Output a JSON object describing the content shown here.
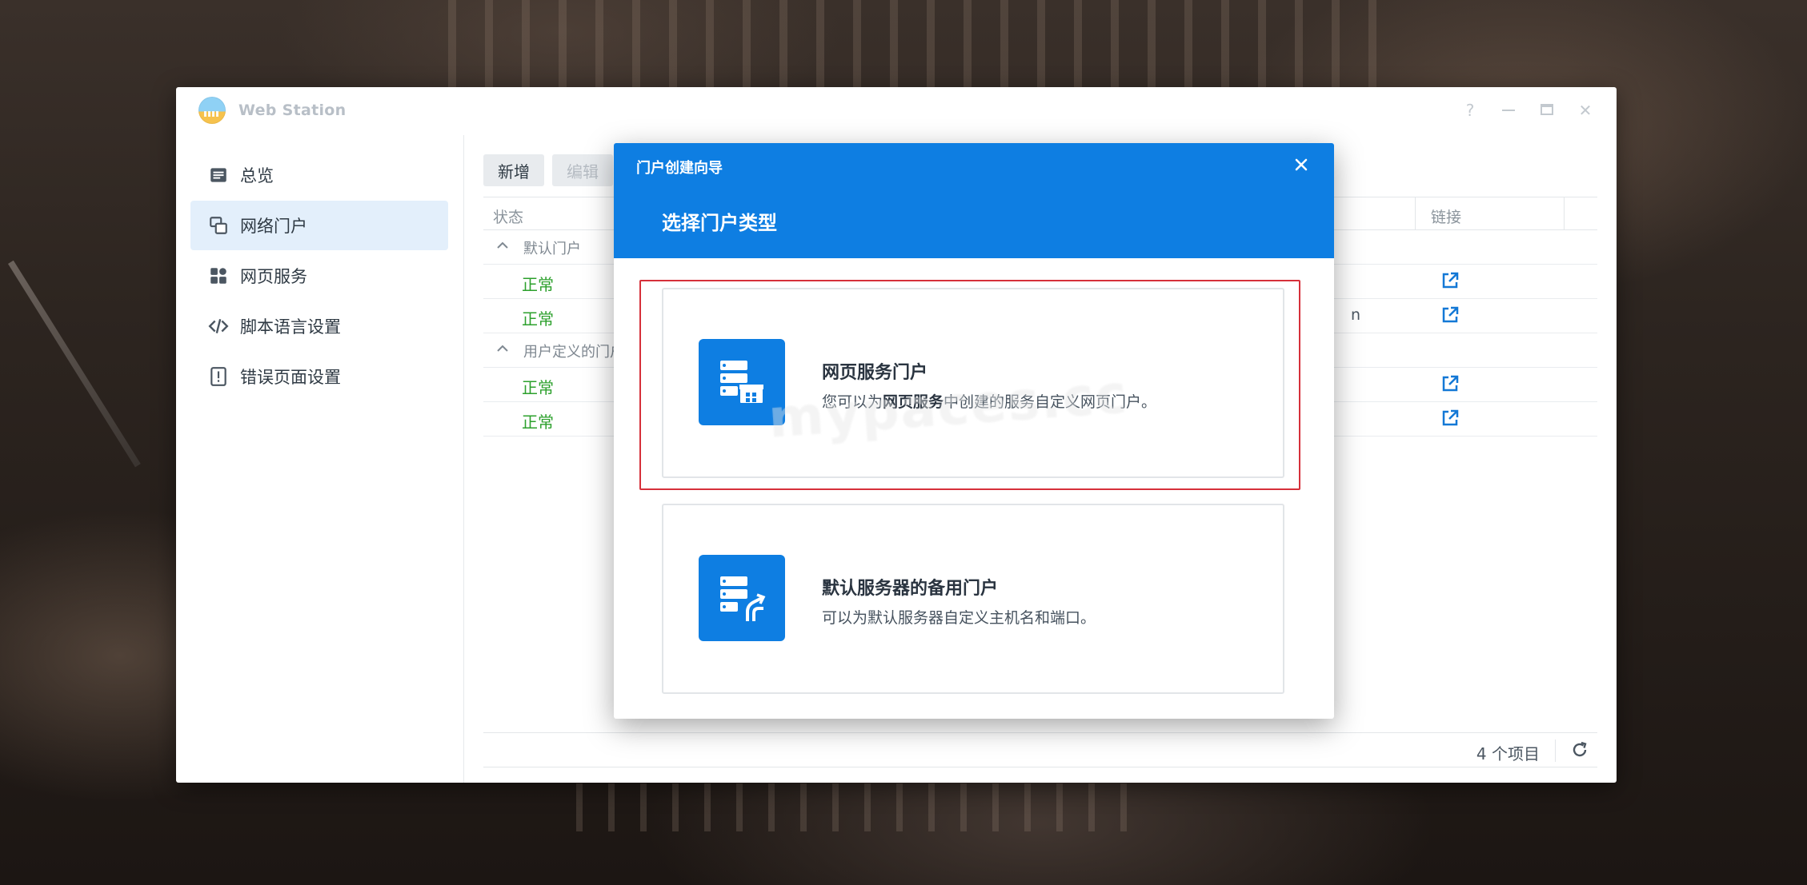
{
  "window": {
    "title": "Web Station",
    "controls": [
      "?",
      "minimize",
      "maximize",
      "close"
    ]
  },
  "sidebar": {
    "items": [
      {
        "label": "总览",
        "icon": "overview-icon",
        "active": false
      },
      {
        "label": "网络门户",
        "icon": "web-portal-icon",
        "active": true
      },
      {
        "label": "网页服务",
        "icon": "web-service-icon",
        "active": false
      },
      {
        "label": "脚本语言设置",
        "icon": "code-icon",
        "active": false
      },
      {
        "label": "错误页面设置",
        "icon": "error-page-icon",
        "active": false
      }
    ]
  },
  "toolbar": {
    "add_label": "新增",
    "edit_label": "编辑"
  },
  "grid": {
    "columns": {
      "status": "状态",
      "link": "链接"
    },
    "groups": [
      {
        "label": "默认门户",
        "rows": [
          {
            "status": "正常",
            "tail": ""
          },
          {
            "status": "正常",
            "tail": "n"
          }
        ]
      },
      {
        "label": "用户定义的门户",
        "rows": [
          {
            "status": "正常",
            "tail": ""
          },
          {
            "status": "正常",
            "tail": ""
          }
        ]
      }
    ],
    "footer": {
      "count": "4 个项目"
    }
  },
  "dialog": {
    "title": "门户创建向导",
    "step_title": "选择门户类型",
    "options": [
      {
        "title": "网页服务门户",
        "desc_prefix": "您可以为",
        "desc_bold": "网页服务",
        "desc_suffix": "中创建的服务自定义网页门户。",
        "selected": true,
        "icon": "web-service-portal-icon"
      },
      {
        "title": "默认服务器的备用门户",
        "desc": "可以为默认服务器自定义主机名和端口。",
        "selected": false,
        "icon": "alternative-portal-icon"
      }
    ]
  },
  "colors": {
    "accent": "#0e7ee2",
    "status_ok": "#2ca02c",
    "highlight": "#d6303a"
  },
  "watermark": {
    "text": "mypaces.cc"
  }
}
